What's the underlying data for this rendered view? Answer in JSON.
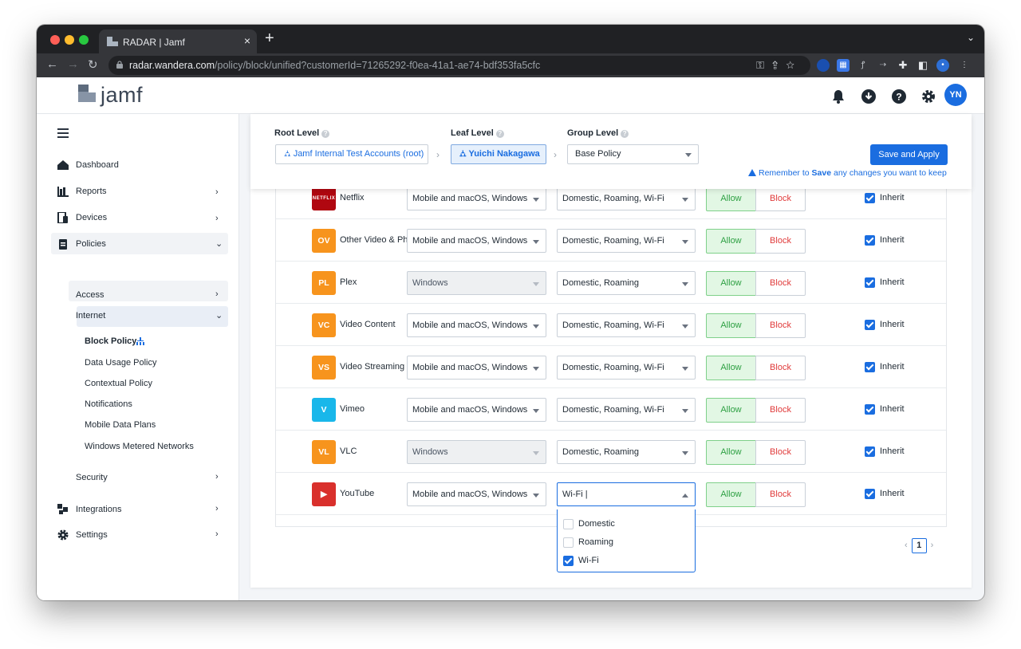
{
  "browser": {
    "tab_title": "RADAR | Jamf",
    "url_host": "radar.wandera.com",
    "url_path": "/policy/block/unified?customerId=71265292-f0ea-41a1-ae74-bdf353fa5cfc"
  },
  "header": {
    "logo_text": "jamf",
    "avatar_initials": "YN"
  },
  "sidebar": {
    "items": [
      {
        "label": "Dashboard",
        "icon": "home-icon"
      },
      {
        "label": "Reports",
        "icon": "bar-chart-icon"
      },
      {
        "label": "Devices",
        "icon": "devices-icon"
      },
      {
        "label": "Policies",
        "icon": "clipboard-icon"
      },
      {
        "label": "Integrations",
        "icon": "puzzle-icon"
      },
      {
        "label": "Settings",
        "icon": "gear-icon"
      }
    ],
    "policies_sub": {
      "access": "Access",
      "internet": "Internet",
      "internet_items": [
        "Block Policy",
        "Data Usage Policy",
        "Contextual Policy",
        "Notifications",
        "Mobile Data Plans",
        "Windows Metered Networks"
      ],
      "security": "Security"
    }
  },
  "levels": {
    "root_label": "Root Level",
    "root_value": "Jamf Internal Test Accounts (root)",
    "leaf_label": "Leaf Level",
    "leaf_value": "Yuichi Nakagawa",
    "group_label": "Group Level",
    "group_value": "Base Policy",
    "save_label": "Save and Apply",
    "remember_pre": "Remember to ",
    "remember_bold": "Save",
    "remember_post": " any changes you want to keep"
  },
  "rows": [
    {
      "app": "Netflix",
      "abbr": "NETFLIX",
      "icon_color": "#b00710",
      "platform": "Mobile and macOS, Windows",
      "platform_disabled": false,
      "network": "Domestic, Roaming, Wi-Fi",
      "allow": "Allow",
      "block": "Block",
      "inherit": "Inherit"
    },
    {
      "app": "Other Video & Photo",
      "abbr": "OV",
      "icon_color": "#f7941d",
      "platform": "Mobile and macOS, Windows",
      "platform_disabled": false,
      "network": "Domestic, Roaming, Wi-Fi",
      "allow": "Allow",
      "block": "Block",
      "inherit": "Inherit"
    },
    {
      "app": "Plex",
      "abbr": "PL",
      "icon_color": "#f7941d",
      "platform": "Windows",
      "platform_disabled": true,
      "network": "Domestic, Roaming",
      "allow": "Allow",
      "block": "Block",
      "inherit": "Inherit"
    },
    {
      "app": "Video Content",
      "abbr": "VC",
      "icon_color": "#f7941d",
      "platform": "Mobile and macOS, Windows",
      "platform_disabled": false,
      "network": "Domestic, Roaming, Wi-Fi",
      "allow": "Allow",
      "block": "Block",
      "inherit": "Inherit"
    },
    {
      "app": "Video Streaming Services",
      "abbr": "VS",
      "icon_color": "#f7941d",
      "platform": "Mobile and macOS, Windows",
      "platform_disabled": false,
      "network": "Domestic, Roaming, Wi-Fi",
      "allow": "Allow",
      "block": "Block",
      "inherit": "Inherit"
    },
    {
      "app": "Vimeo",
      "abbr": "V",
      "icon_color": "#19b7ea",
      "platform": "Mobile and macOS, Windows",
      "platform_disabled": false,
      "network": "Domestic, Roaming, Wi-Fi",
      "allow": "Allow",
      "block": "Block",
      "inherit": "Inherit"
    },
    {
      "app": "VLC",
      "abbr": "VL",
      "icon_color": "#f7941d",
      "platform": "Windows",
      "platform_disabled": true,
      "network": "Domestic, Roaming",
      "allow": "Allow",
      "block": "Block",
      "inherit": "Inherit"
    },
    {
      "app": "YouTube",
      "abbr": "▶",
      "icon_color": "#d9302c",
      "platform": "Mobile and macOS, Windows",
      "platform_disabled": false,
      "network": "Wi-Fi |",
      "allow": "Allow",
      "block": "Block",
      "inherit": "Inherit"
    }
  ],
  "network_dropdown": {
    "options": [
      {
        "label": "Domestic",
        "checked": false
      },
      {
        "label": "Roaming",
        "checked": false
      },
      {
        "label": "Wi-Fi",
        "checked": true
      }
    ]
  },
  "pagination": {
    "current": "1",
    "prev": "‹",
    "next": "›"
  },
  "colors": {
    "accent": "#1a6de0",
    "allow": "#2ea043",
    "block": "#e03a3a"
  }
}
